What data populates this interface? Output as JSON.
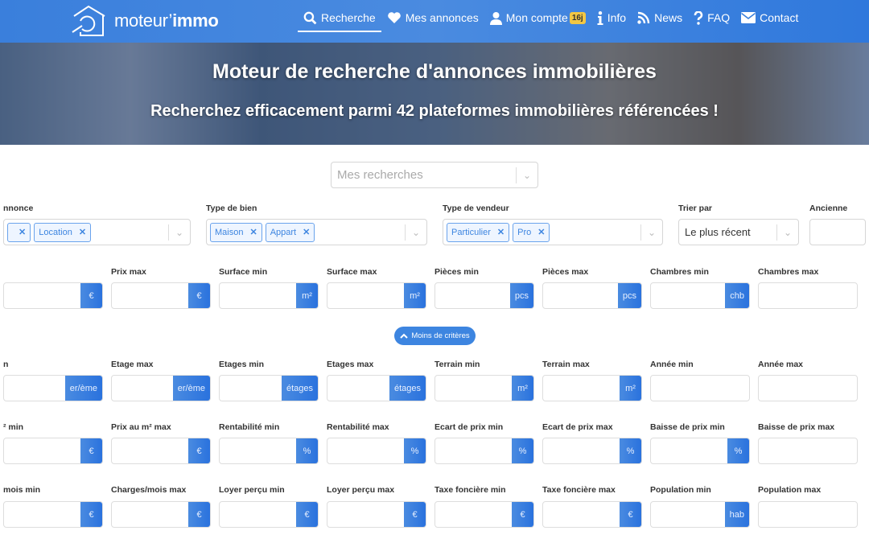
{
  "nav": {
    "logo_text": "moteur’",
    "logo_bold": "immo",
    "items": [
      {
        "label": "Recherche",
        "icon": "search-icon"
      },
      {
        "label": "Mes annonces",
        "icon": "heart-icon"
      },
      {
        "label": "Mon compte",
        "icon": "user-icon",
        "badge": "16j"
      },
      {
        "label": "Info",
        "icon": "info-icon"
      },
      {
        "label": "News",
        "icon": "rss-icon"
      },
      {
        "label": "FAQ",
        "icon": "question-icon"
      },
      {
        "label": "Contact",
        "icon": "envelope-icon"
      }
    ]
  },
  "hero": {
    "title": "Moteur de recherche d'annonces immobilières",
    "subtitle": "Recherchez efficacement parmi 42 plateformes immobilières référencées !"
  },
  "saved_searches": {
    "placeholder": "Mes recherches"
  },
  "selects": [
    {
      "label": "nnonce",
      "chips": [
        "",
        "Location"
      ]
    },
    {
      "label": "Type de bien",
      "chips": [
        "Maison",
        "Appart"
      ]
    },
    {
      "label": "Type de vendeur",
      "chips": [
        "Particulier",
        "Pro"
      ]
    },
    {
      "label": "Trier par",
      "value": "Le plus récent"
    },
    {
      "label": "Ancienne"
    }
  ],
  "less_criteria_label": "Moins de critères",
  "field_rows": [
    [
      {
        "label": "",
        "unit": "€"
      },
      {
        "label": "Prix max",
        "unit": "€"
      },
      {
        "label": "Surface min",
        "unit": "m²"
      },
      {
        "label": "Surface max",
        "unit": "m²"
      },
      {
        "label": "Pièces min",
        "unit": "pcs"
      },
      {
        "label": "Pièces max",
        "unit": "pcs"
      },
      {
        "label": "Chambres min",
        "unit": "chb"
      },
      {
        "label": "Chambres max",
        "unit": ""
      }
    ],
    [
      {
        "label": "n",
        "unit": "er/ème"
      },
      {
        "label": "Etage max",
        "unit": "er/ème"
      },
      {
        "label": "Etages min",
        "unit": "étages"
      },
      {
        "label": "Etages max",
        "unit": "étages"
      },
      {
        "label": "Terrain min",
        "unit": "m²"
      },
      {
        "label": "Terrain max",
        "unit": "m²"
      },
      {
        "label": "Année min",
        "unit": ""
      },
      {
        "label": "Année max",
        "unit": ""
      }
    ],
    [
      {
        "label": "² min",
        "unit": "€"
      },
      {
        "label": "Prix au m² max",
        "unit": "€"
      },
      {
        "label": "Rentabilité min",
        "unit": "%"
      },
      {
        "label": "Rentabilité max",
        "unit": "%"
      },
      {
        "label": "Ecart de prix min",
        "unit": "%"
      },
      {
        "label": "Ecart de prix max",
        "unit": "%"
      },
      {
        "label": "Baisse de prix min",
        "unit": "%"
      },
      {
        "label": "Baisse de prix max",
        "unit": ""
      }
    ],
    [
      {
        "label": "mois min",
        "unit": "€"
      },
      {
        "label": "Charges/mois max",
        "unit": "€"
      },
      {
        "label": "Loyer perçu min",
        "unit": "€"
      },
      {
        "label": "Loyer perçu max",
        "unit": "€"
      },
      {
        "label": "Taxe foncière min",
        "unit": "€"
      },
      {
        "label": "Taxe foncière max",
        "unit": "€"
      },
      {
        "label": "Population min",
        "unit": "hab"
      },
      {
        "label": "Population max",
        "unit": ""
      }
    ]
  ],
  "colors": {
    "primary": "#3d85e0",
    "badge": "#f2c744"
  }
}
